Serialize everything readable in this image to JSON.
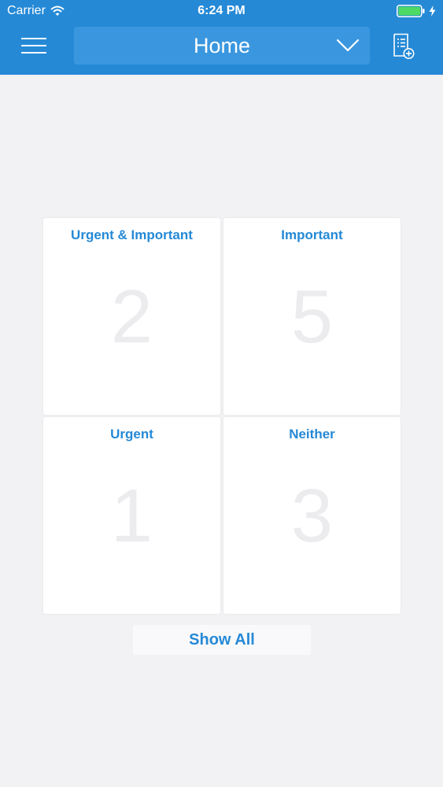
{
  "status_bar": {
    "carrier": "Carrier",
    "time": "6:24 PM",
    "icons": [
      "wifi-icon",
      "battery-icon",
      "charging-bolt-icon"
    ]
  },
  "nav": {
    "title": "Home",
    "menu_icon": "hamburger-menu-icon",
    "dropdown_icon": "chevron-down-icon",
    "action_icon": "new-list-icon"
  },
  "quadrants": [
    {
      "title": "Urgent & Important",
      "count": "2"
    },
    {
      "title": "Important",
      "count": "5"
    },
    {
      "title": "Urgent",
      "count": "1"
    },
    {
      "title": "Neither",
      "count": "3"
    }
  ],
  "show_all_label": "Show All",
  "colors": {
    "accent": "#2589d6",
    "header_bg": "#2589d6",
    "dropdown_bg": "#3a97df",
    "page_bg": "#f2f2f4",
    "count_text": "#ececef",
    "battery": "#4cd964"
  }
}
